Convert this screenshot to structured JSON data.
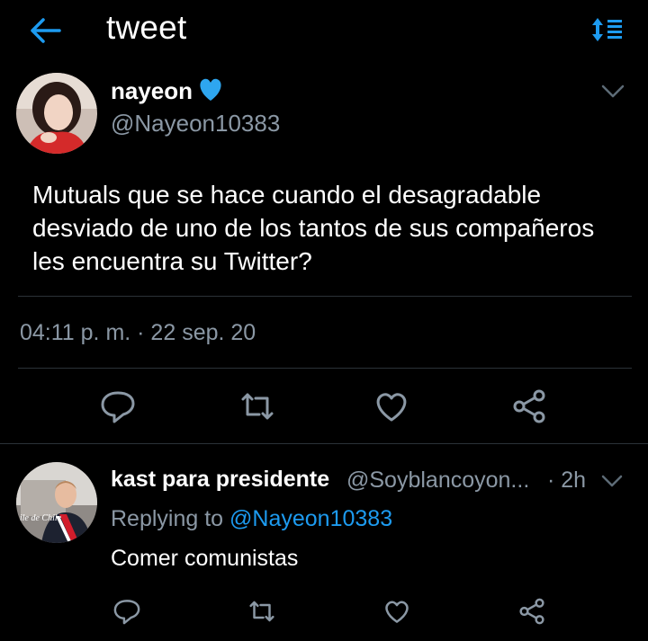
{
  "header": {
    "title": "tweet",
    "back_icon": "arrow-left-icon",
    "sort_icon": "sort-arrows-icon",
    "accent": "#1d9bf0"
  },
  "tweet": {
    "name": "nayeon",
    "badge_icon": "blue-heart-icon",
    "handle": "@Nayeon10383",
    "text": "Mutuals que se hace cuando el desagradable desviado de uno de los tantos de sus compañeros les encuentra su Twitter?",
    "timestamp": "04:11 p. m. · 22 sep. 20",
    "actions": [
      "reply-icon",
      "retweet-icon",
      "like-icon",
      "share-icon"
    ]
  },
  "reply": {
    "name": "kast para presidente",
    "handle": "@Soyblancoyon...",
    "time": "· 2h",
    "replying_prefix": "Replying to",
    "replying_handle": "@Nayeon10383",
    "text": "Comer comunistas",
    "avatar_caption": "ile de Chile",
    "actions": [
      "reply-icon",
      "retweet-icon",
      "like-icon",
      "share-icon"
    ]
  },
  "colors": {
    "background": "#000000",
    "secondary_text": "#8b98a5",
    "divider": "#2b3238",
    "icon": "#8b98a5"
  }
}
